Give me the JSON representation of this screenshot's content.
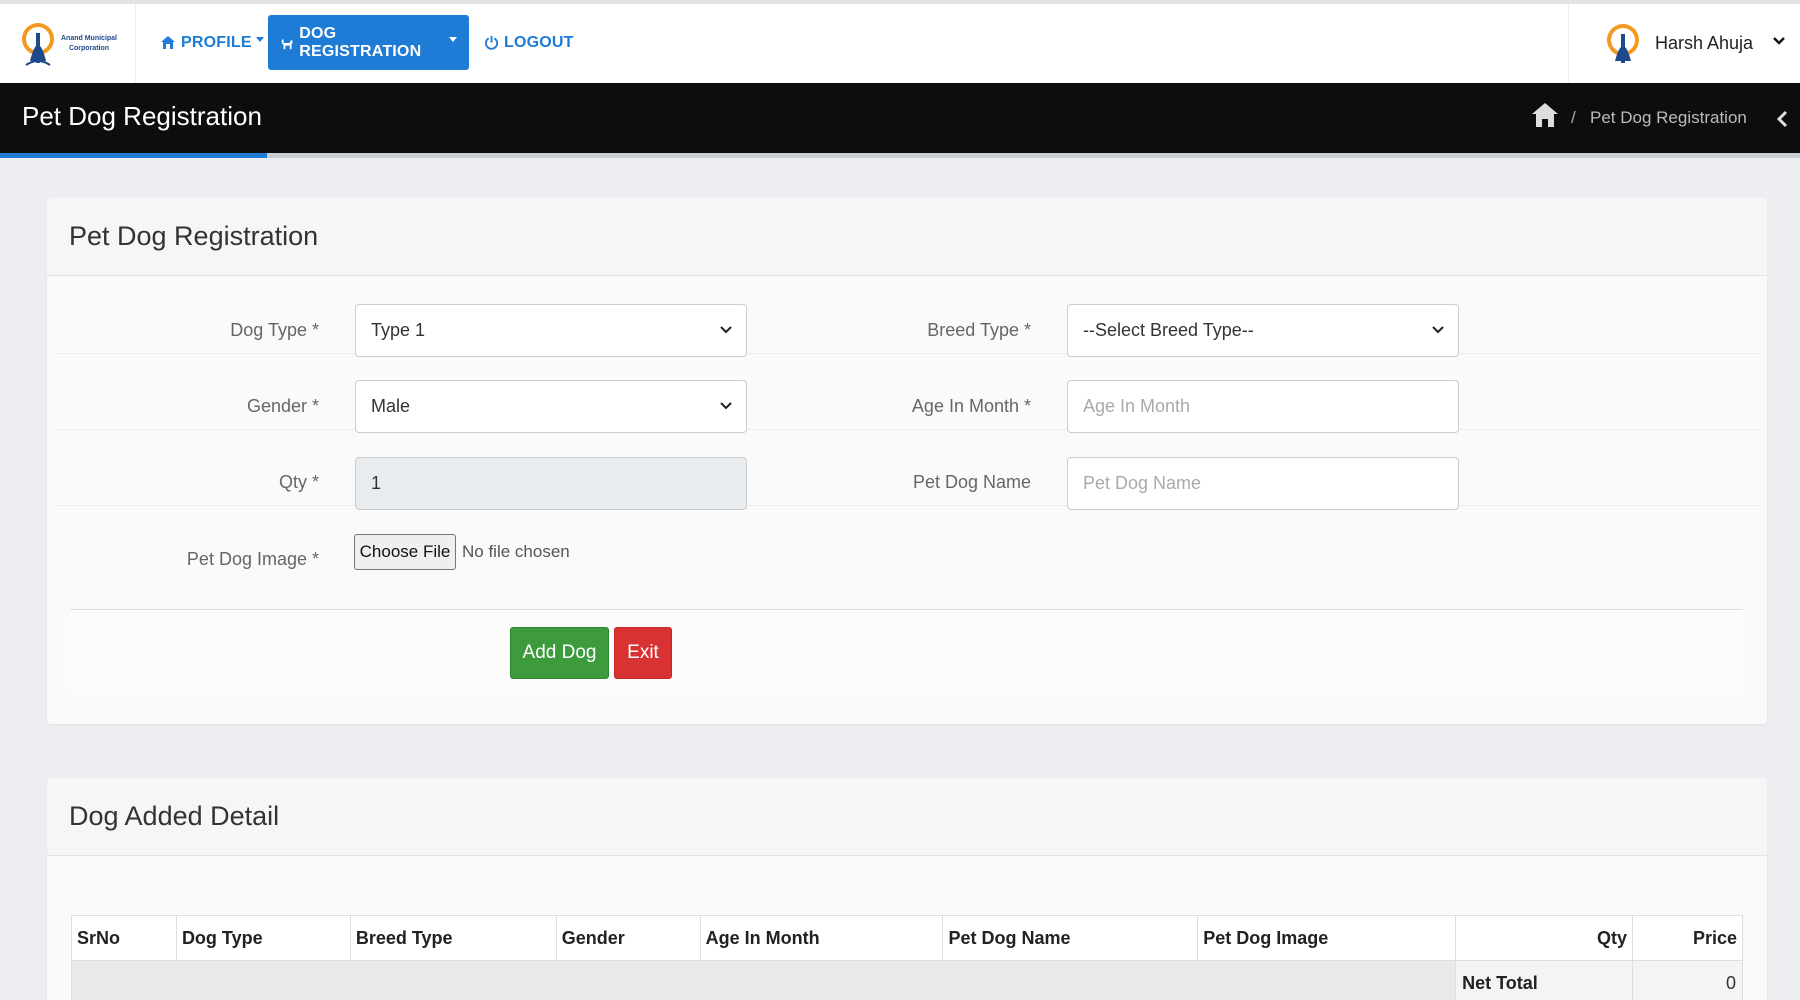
{
  "nav": {
    "logo_text": "Anand Municipal Corporation",
    "profile_label": "PROFILE",
    "dog_registration_label": "DOG REGISTRATION",
    "logout_label": "LOGOUT",
    "user_name": "Harsh Ahuja"
  },
  "titlebar": {
    "title": "Pet Dog Registration",
    "breadcrumb_current": "Pet Dog Registration",
    "breadcrumb_separator": "/"
  },
  "form": {
    "header": "Pet Dog Registration",
    "dog_type": {
      "label": "Dog Type *",
      "value": "Type 1"
    },
    "breed_type": {
      "label": "Breed Type *",
      "value": "--Select Breed Type--"
    },
    "gender": {
      "label": "Gender *",
      "value": "Male"
    },
    "age": {
      "label": "Age In Month *",
      "placeholder": "Age In Month"
    },
    "qty": {
      "label": "Qty *",
      "value": "1"
    },
    "pet_name": {
      "label": "Pet Dog Name",
      "placeholder": "Pet Dog Name"
    },
    "image": {
      "label": "Pet Dog Image *",
      "button": "Choose File",
      "status": "No file chosen"
    },
    "add_button": "Add Dog",
    "exit_button": "Exit"
  },
  "detail": {
    "header": "Dog Added Detail",
    "columns": [
      "SrNo",
      "Dog Type",
      "Breed Type",
      "Gender",
      "Age In Month",
      "Pet Dog Name",
      "Pet Dog Image",
      "Qty",
      "Price"
    ],
    "net_total_label": "Net Total",
    "net_total_value": "0"
  },
  "colors": {
    "primary": "#1e7bd6",
    "success": "#3d9b3d",
    "danger": "#d83232",
    "titlebar": "#0d0d0d"
  }
}
